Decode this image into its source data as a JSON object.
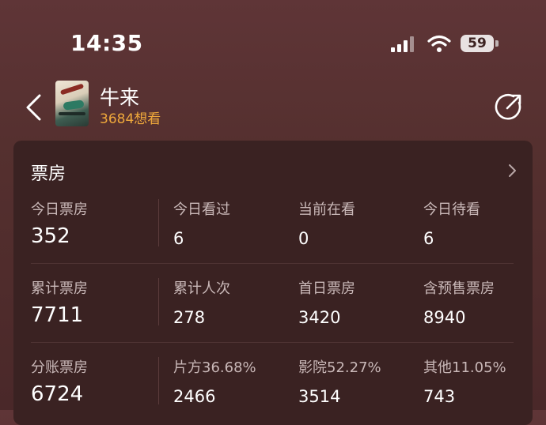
{
  "status_bar": {
    "time": "14:35",
    "battery": "59",
    "icons": [
      "cellular-signal-icon",
      "wifi-icon",
      "battery-icon"
    ]
  },
  "header": {
    "title": "牛来",
    "want_count": "3684想看",
    "icons": [
      "back-arrow-icon",
      "share-icon"
    ]
  },
  "box_office": {
    "title": "票房",
    "rows": [
      [
        {
          "label": "今日票房",
          "value": "352"
        },
        {
          "label": "今日看过",
          "value": "6"
        },
        {
          "label": "当前在看",
          "value": "0"
        },
        {
          "label": "今日待看",
          "value": "6"
        }
      ],
      [
        {
          "label": "累计票房",
          "value": "7711"
        },
        {
          "label": "累计人次",
          "value": "278"
        },
        {
          "label": "首日票房",
          "value": "3420"
        },
        {
          "label": "含预售票房",
          "value": "8940"
        }
      ],
      [
        {
          "label": "分账票房",
          "value": "6724"
        },
        {
          "label": "片方36.68%",
          "value": "2466"
        },
        {
          "label": "影院52.27%",
          "value": "3514"
        },
        {
          "label": "其他11.05%",
          "value": "743"
        }
      ]
    ]
  },
  "colors": {
    "accent": "#f0a93b",
    "background": "#55302f",
    "card": "#3a2222"
  }
}
